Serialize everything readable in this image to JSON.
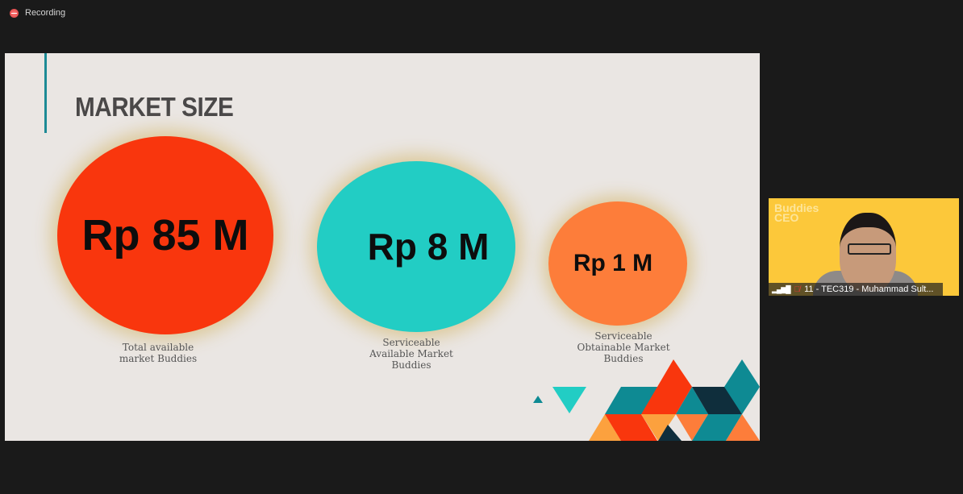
{
  "recording": {
    "label": "Recording",
    "icon": "record-icon"
  },
  "slide": {
    "title": "MARKET SIZE",
    "circles": [
      {
        "value": "Rp 85 M",
        "label_lines": [
          "Total available",
          "market Buddies"
        ],
        "color": "#f9360d"
      },
      {
        "value": "Rp 8 M",
        "label_lines": [
          "Serviceable",
          "Available Market",
          "Buddies"
        ],
        "color": "#22cdc4"
      },
      {
        "value": "Rp 1 M",
        "label_lines": [
          "Serviceable",
          "Obtainable Market",
          "Buddies"
        ],
        "color": "#fd7d3a"
      }
    ]
  },
  "video": {
    "background_text": [
      "Buddies",
      "CEO"
    ],
    "participant": "11 - TEC319 - Muhammad Sult...",
    "mic": "muted",
    "signal_icon": "signal-icon"
  }
}
